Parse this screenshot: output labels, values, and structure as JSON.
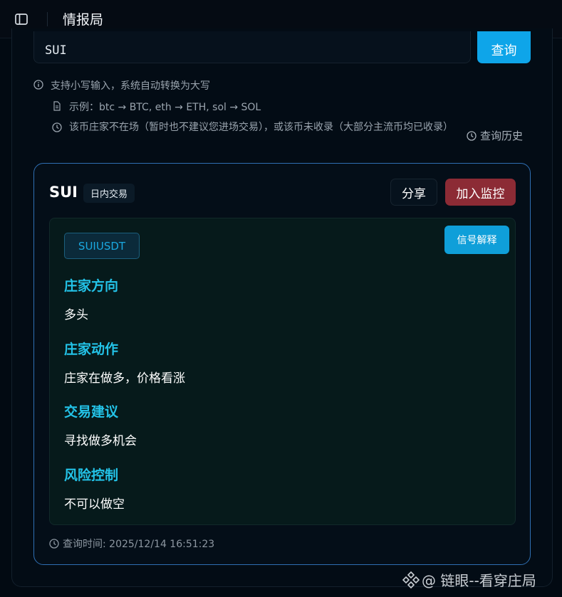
{
  "app": {
    "title": "情报局"
  },
  "search": {
    "value": "SUI",
    "button_label": "查询"
  },
  "hints": {
    "lowercase": "支持小写输入，系统自动转换为大写",
    "example": "示例：btc → BTC, eth → ETH, sol → SOL",
    "absent": "该币庄家不在场（暂时也不建议您进场交易），或该币未收录（大部分主流币均已收录）"
  },
  "history_label": "查询历史",
  "result": {
    "symbol": "SUI",
    "mode": "日内交易",
    "share_label": "分享",
    "monitor_label": "加入监控",
    "pair": "SUIUSDT",
    "explain_label": "信号解释",
    "sections": [
      {
        "title": "庄家方向",
        "value": "多头"
      },
      {
        "title": "庄家动作",
        "value": "庄家在做多，价格看涨"
      },
      {
        "title": "交易建议",
        "value": "寻找做多机会"
      },
      {
        "title": "风险控制",
        "value": "不可以做空"
      }
    ],
    "query_time": "查询时间: 2025/12/14 16:51:23"
  },
  "watermark": "@ 链眼--看穿庄局",
  "colors": {
    "accent": "#0ea5e9",
    "danger": "#8c2b35",
    "section_title": "#23c3e8",
    "card_border": "#2f6fb3"
  }
}
